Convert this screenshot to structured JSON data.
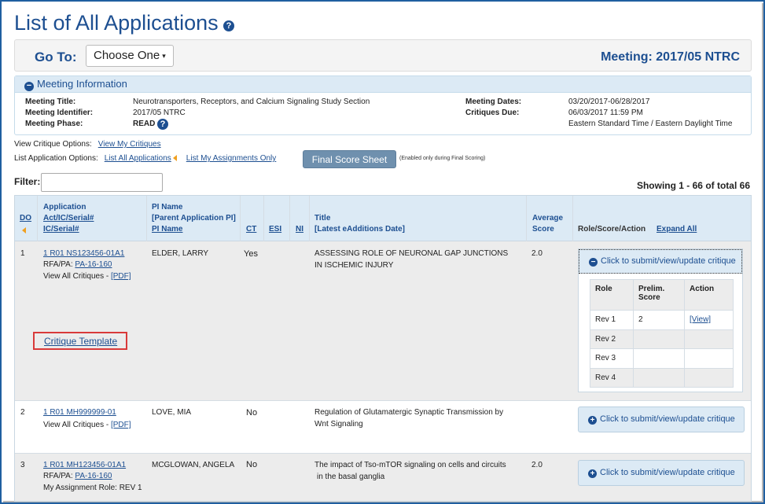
{
  "page": {
    "title": "List of All Applications",
    "help_glyph": "?"
  },
  "goto": {
    "label": "Go To:",
    "select_value": "Choose One",
    "meeting": "Meeting: 2017/05 NTRC"
  },
  "meeting_info": {
    "header": "Meeting Information",
    "toggle_glyph": "−",
    "fields": {
      "title_label": "Meeting Title:",
      "title_value": "Neurotransporters, Receptors, and Calcium Signaling Study Section",
      "identifier_label": "Meeting Identifier:",
      "identifier_value": "2017/05 NTRC",
      "phase_label": "Meeting Phase:",
      "phase_value": "READ",
      "dates_label": "Meeting Dates:",
      "dates_value": "03/20/2017-06/28/2017",
      "due_label": "Critiques Due:",
      "due_value": "06/03/2017 11:59 PM",
      "timezone_value": "Eastern Standard Time / Eastern Daylight Time"
    }
  },
  "options": {
    "view_label": "View Critique Options:",
    "view_link": "View My Critiques",
    "list_label": "List Application Options:",
    "list_all_link": "List All Applications",
    "list_mine_link": "List My Assignments Only",
    "final_button": "Final Score Sheet",
    "final_note": "(Enabled only during Final Scoring)"
  },
  "filter": {
    "label": "Filter:",
    "value": "",
    "showing": "Showing 1 - 66 of total 66"
  },
  "table": {
    "headers": {
      "do": "DO",
      "app_line1": "Application",
      "app_line2": "Act/IC/Serial#",
      "app_line3": "IC/Serial#",
      "pi_line1": "PI Name",
      "pi_line2": "[Parent Application PI]",
      "pi_line3": "PI Name",
      "ct": "CT",
      "esi": "ESI",
      "ni": "NI",
      "title_line1": "Title",
      "title_line2": "[Latest eAdditions Date]",
      "score_line1": "Average",
      "score_line2": "Score",
      "role": "Role/Score/Action",
      "expand": "Expand All"
    },
    "rows": [
      {
        "do": "1",
        "app": "1 R01 NS123456-01A1",
        "rfa_label": "RFA/PA:",
        "rfa": "PA-16-160",
        "view_all": "View All Critiques -",
        "pdf": "[PDF]",
        "critique_template": "Critique Template",
        "pi": "ELDER, LARRY",
        "ct": "Yes",
        "title_l1": "ASSESSING ROLE OF NEURONAL GAP JUNCTIONS",
        "title_l2": "IN ISCHEMIC INJURY",
        "score": "2.0",
        "critique_btn": "Click to submit/view/update critique",
        "roles_header": {
          "role": "Role",
          "prelim_l1": "Prelim.",
          "prelim_l2": "Score",
          "action": "Action"
        },
        "roles": [
          {
            "role": "Rev 1",
            "score": "2",
            "action": "[View]"
          },
          {
            "role": "Rev 2",
            "score": "",
            "action": ""
          },
          {
            "role": "Rev 3",
            "score": "",
            "action": ""
          },
          {
            "role": "Rev 4",
            "score": "",
            "action": ""
          }
        ]
      },
      {
        "do": "2",
        "app": "1 R01 MH999999-01",
        "view_all": "View All Critiques -",
        "pdf": "[PDF]",
        "pi": "LOVE, MIA",
        "ct": "No",
        "title_l1": "Regulation of Glutamatergic Synaptic Transmission by",
        "title_l2": "Wnt Signaling",
        "score": "",
        "critique_btn": "Click to submit/view/update critique"
      },
      {
        "do": "3",
        "app": "1 R01 MH123456-01A1",
        "rfa_label": "RFA/PA:",
        "rfa": "PA-16-160",
        "assignment": "My Assignment Role: REV 1",
        "pi": "MCGLOWAN, ANGELA",
        "ct": "No",
        "title_l1": "The impact of Tso-mTOR signaling on cells and circuits",
        "title_l2": "in the basal ganglia",
        "score": "2.0",
        "critique_btn": "Click to submit/view/update critique"
      }
    ]
  },
  "icons": {
    "plus": "+",
    "minus": "−",
    "caret": "▾"
  },
  "colors": {
    "brand": "#1d4f91",
    "header_bg": "#dceaf5",
    "highlight_box": "#d93a3a",
    "button_bg": "#6f90ae"
  }
}
